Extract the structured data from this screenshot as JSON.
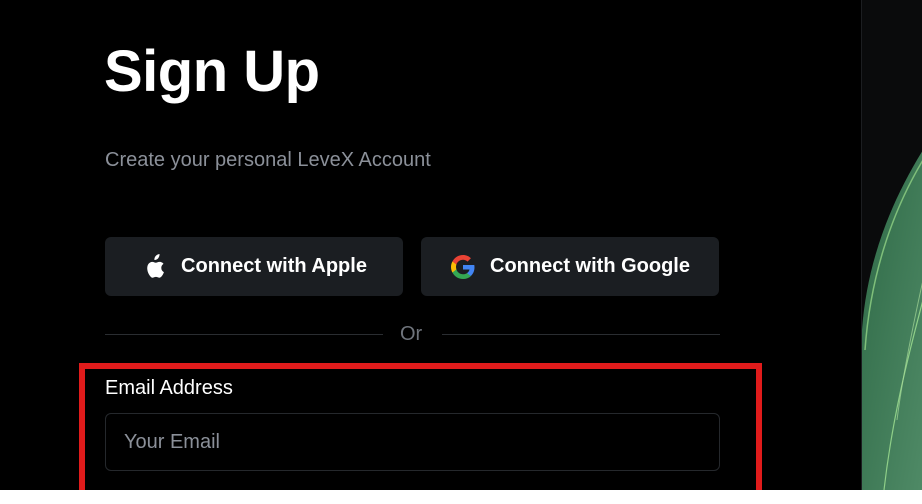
{
  "header": {
    "title": "Sign Up",
    "subtitle": "Create your personal LeveX Account"
  },
  "social": {
    "apple": {
      "label": "Connect with Apple",
      "icon": "apple-icon"
    },
    "google": {
      "label": "Connect with Google",
      "icon": "google-icon"
    }
  },
  "divider": {
    "text": "Or"
  },
  "email": {
    "label": "Email Address",
    "placeholder": "Your Email",
    "value": ""
  },
  "colors": {
    "background": "#000000",
    "button_bg": "#1b1e22",
    "subtitle": "#8b9099",
    "highlight": "#e01b1b",
    "panel_green": "#3e7a58"
  }
}
